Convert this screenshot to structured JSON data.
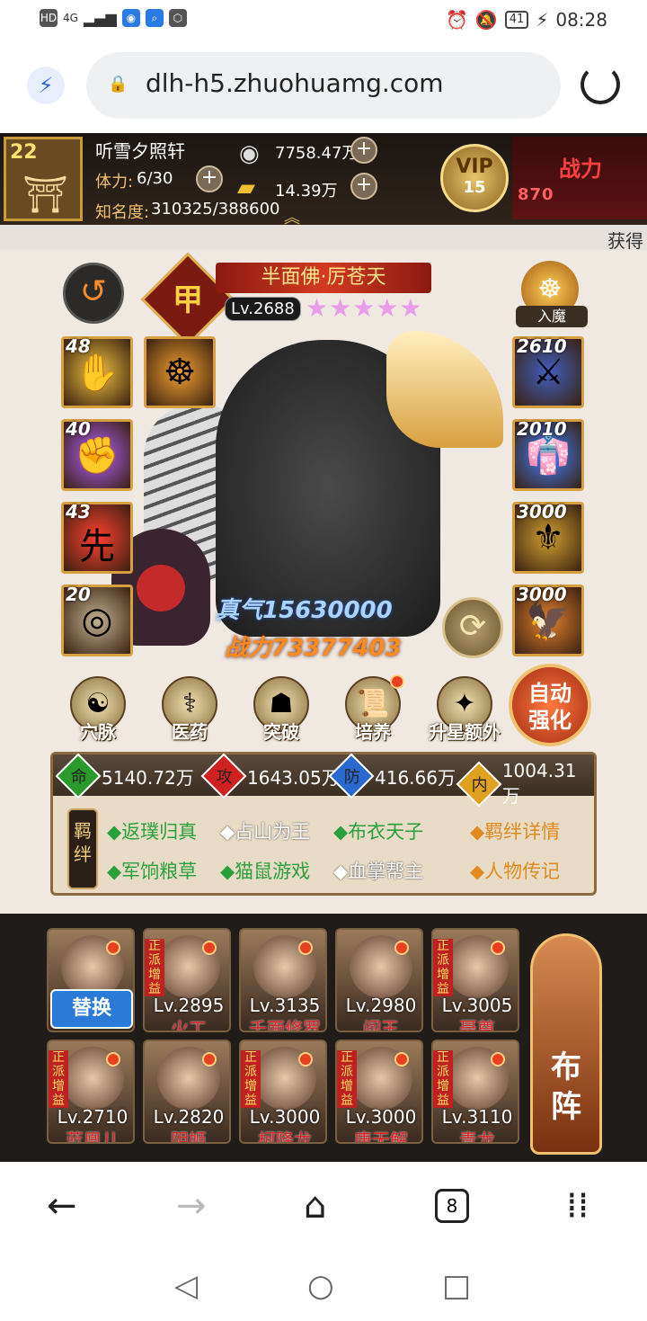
{
  "status": {
    "network": "4G",
    "battery": "41",
    "time": "08:28"
  },
  "browser": {
    "url": "dlh-h5.zhuohuamg.com",
    "tab_count": "8"
  },
  "player": {
    "level": "22",
    "name": "听雪夕照轩",
    "stamina_label": "体力:",
    "stamina_value": "6/30",
    "fame_label": "知名度:",
    "fame_value": "310325/388600",
    "silver": "7758.47万",
    "gold": "14.39万",
    "vip_label": "VIP",
    "vip_level": "15",
    "power_title": "战力",
    "power_partial": "870"
  },
  "ticker": "获得",
  "hero": {
    "rank": "甲",
    "name": "半面佛·厉苍天",
    "level": "Lv.2688",
    "stars": 5,
    "rumo_label": "入魔",
    "zhenqi": "真气15630000",
    "zhanli": "战力73377403"
  },
  "left_slots": [
    {
      "num": "48",
      "glyph": "✋",
      "color": "#f0c040"
    },
    {
      "num": "",
      "glyph": "☸",
      "color": "#f0a030"
    },
    {
      "num": "40",
      "glyph": "✊",
      "color": "#b060ff"
    },
    {
      "num": "43",
      "glyph": "先",
      "color": "#ff4030"
    },
    {
      "num": "20",
      "glyph": "◎",
      "color": "#c0b090"
    }
  ],
  "right_slots": [
    {
      "num": "2610",
      "glyph": "⚔",
      "color": "#4060c0"
    },
    {
      "num": "2010",
      "glyph": "👘",
      "color": "#4080ff"
    },
    {
      "num": "3000",
      "glyph": "⚜",
      "color": "#d0a030"
    },
    {
      "num": "3000",
      "glyph": "🦅",
      "color": "#e08030"
    }
  ],
  "functions": [
    {
      "label": "穴脉",
      "icon": "☯"
    },
    {
      "label": "医药",
      "icon": "⚕"
    },
    {
      "label": "突破",
      "icon": "☗"
    },
    {
      "label": "培养",
      "icon": "📜"
    },
    {
      "label": "升星额外",
      "icon": "✦"
    }
  ],
  "auto_strengthen": "自动强化",
  "attributes": [
    {
      "icon": "命",
      "value": "5140.72万",
      "color": "#2a9a2a"
    },
    {
      "icon": "攻",
      "value": "1643.05万",
      "color": "#d02020"
    },
    {
      "icon": "防",
      "value": "416.66万",
      "color": "#2a6ad0"
    },
    {
      "icon": "内",
      "value": "1004.31万",
      "color": "#e0a020"
    }
  ],
  "jiban_label": "羁绊",
  "bonds_row1": [
    {
      "text": "◆返璞归真",
      "active": true
    },
    {
      "text": "◆占山为王",
      "active": false
    },
    {
      "text": "◆布衣天子",
      "active": true
    }
  ],
  "bonds_row2": [
    {
      "text": "◆军饷粮草",
      "active": true
    },
    {
      "text": "◆猫鼠游戏",
      "active": true
    },
    {
      "text": "◆血掌帮主",
      "active": false
    }
  ],
  "bond_detail_link": "◆羁绊详情",
  "biography_link": "◆人物传记",
  "roster_row1": [
    {
      "level": "",
      "name": "",
      "tag": "",
      "swap": "替换"
    },
    {
      "level": "Lv.2895",
      "name": "火工",
      "tag": "正派增益"
    },
    {
      "level": "Lv.3135",
      "name": "千面修罗",
      "tag": ""
    },
    {
      "level": "Lv.2980",
      "name": "阎王",
      "tag": ""
    },
    {
      "level": "Lv.3005",
      "name": "聂尊",
      "tag": "正派增益"
    }
  ],
  "roster_row2": [
    {
      "level": "Lv.2710",
      "name": "蓝凰儿",
      "tag": "正派增益"
    },
    {
      "level": "Lv.2820",
      "name": "阴姬",
      "tag": ""
    },
    {
      "level": "Lv.3000",
      "name": "柯降龙",
      "tag": "正派增益"
    },
    {
      "level": "Lv.3000",
      "name": "唐无解",
      "tag": "正派增益"
    },
    {
      "level": "Lv.3110",
      "name": "青龙",
      "tag": "正派增益"
    }
  ],
  "formation_button": "布阵"
}
